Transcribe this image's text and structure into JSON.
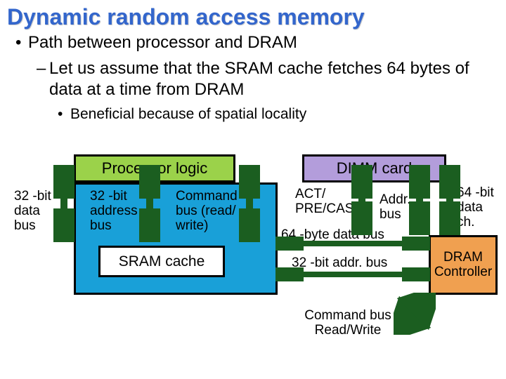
{
  "title": "Dynamic random access memory",
  "bullets": {
    "b1": "Path between processor and DRAM",
    "b2": "Let us assume that the SRAM cache fetches 64 bytes of data at a time from DRAM",
    "b3": "Beneficial because of spatial locality"
  },
  "boxes": {
    "proc_logic": "Processor logic",
    "dimm": "DIMM card",
    "sram": "SRAM cache",
    "dram": "DRAM Controller"
  },
  "labels": {
    "l_32data": "32 -bit data bus",
    "l_32addr": "32 -bit address bus",
    "l_cmd": "Command bus (read/ write)",
    "l_act": "ACT/ PRE/CAS",
    "l_addr": "Addr. bus",
    "l_64data": "64 -bit data ch.",
    "l_64bus": "64 -byte data bus",
    "l_32addr2": "32 -bit addr. bus",
    "l_cmdrw": "Command bus Read/Write"
  }
}
